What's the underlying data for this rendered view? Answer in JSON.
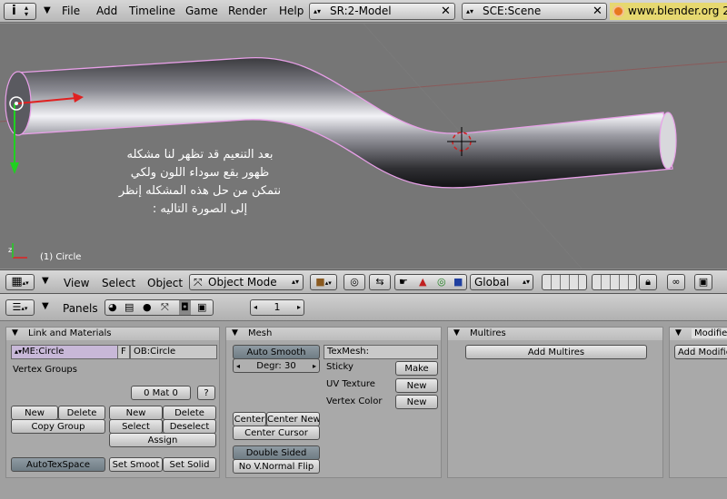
{
  "topbar": {
    "menus": [
      "File",
      "Add",
      "Timeline",
      "Game",
      "Render",
      "Help"
    ],
    "screen": "SR:2-Model",
    "scene": "SCE:Scene",
    "url": "www.blender.org 2"
  },
  "viewport": {
    "object_label": "(1) Circle",
    "note_lines": [
      "بعد التنعيم قد تظهر لنا مشكله",
      "ظهور بقع سوداء اللون ولكي",
      "نتمكن من حل هذه المشكله إنظر",
      "إلى الصورة التاليه :"
    ],
    "colors": {
      "background": "#767676",
      "tube_outline": "#e8a0e8",
      "x_axis": "#e02020",
      "y_axis": "#20d020",
      "grid_red": "#b04040"
    }
  },
  "view_header": {
    "view": "View",
    "select": "Select",
    "object": "Object",
    "mode": "Object Mode",
    "orientation": "Global"
  },
  "buttons_header": {
    "panels": "Panels",
    "frame": "1"
  },
  "link_panel": {
    "title": "Link and Materials",
    "mesh_name": "ME:Circle",
    "f_label": "F",
    "ob_name": "OB:Circle",
    "vertex_groups": "Vertex Groups",
    "mat": "0 Mat 0",
    "q": "?",
    "new1": "New",
    "delete1": "Delete",
    "copy_group": "Copy Group",
    "new2": "New",
    "delete2": "Delete",
    "select": "Select",
    "deselect": "Deselect",
    "assign": "Assign",
    "autotex": "AutoTexSpace",
    "set_smooth": "Set Smoot",
    "set_solid": "Set Solid"
  },
  "mesh_panel": {
    "title": "Mesh",
    "auto_smooth": "Auto Smooth",
    "degr": "Degr: 30",
    "texmesh": "TexMesh:",
    "sticky": "Sticky",
    "make": "Make",
    "uv_texture": "UV Texture",
    "new_uv": "New",
    "vertex_color": "Vertex Color",
    "new_vc": "New",
    "center": "Center",
    "center_new": "Center New",
    "center_cursor": "Center Cursor",
    "double_sided": "Double Sided",
    "no_vnormal": "No V.Normal Flip"
  },
  "multires_panel": {
    "title": "Multires",
    "add": "Add Multires"
  },
  "modifiers_panel": {
    "title": "Modifie",
    "add": "Add Modifie"
  }
}
